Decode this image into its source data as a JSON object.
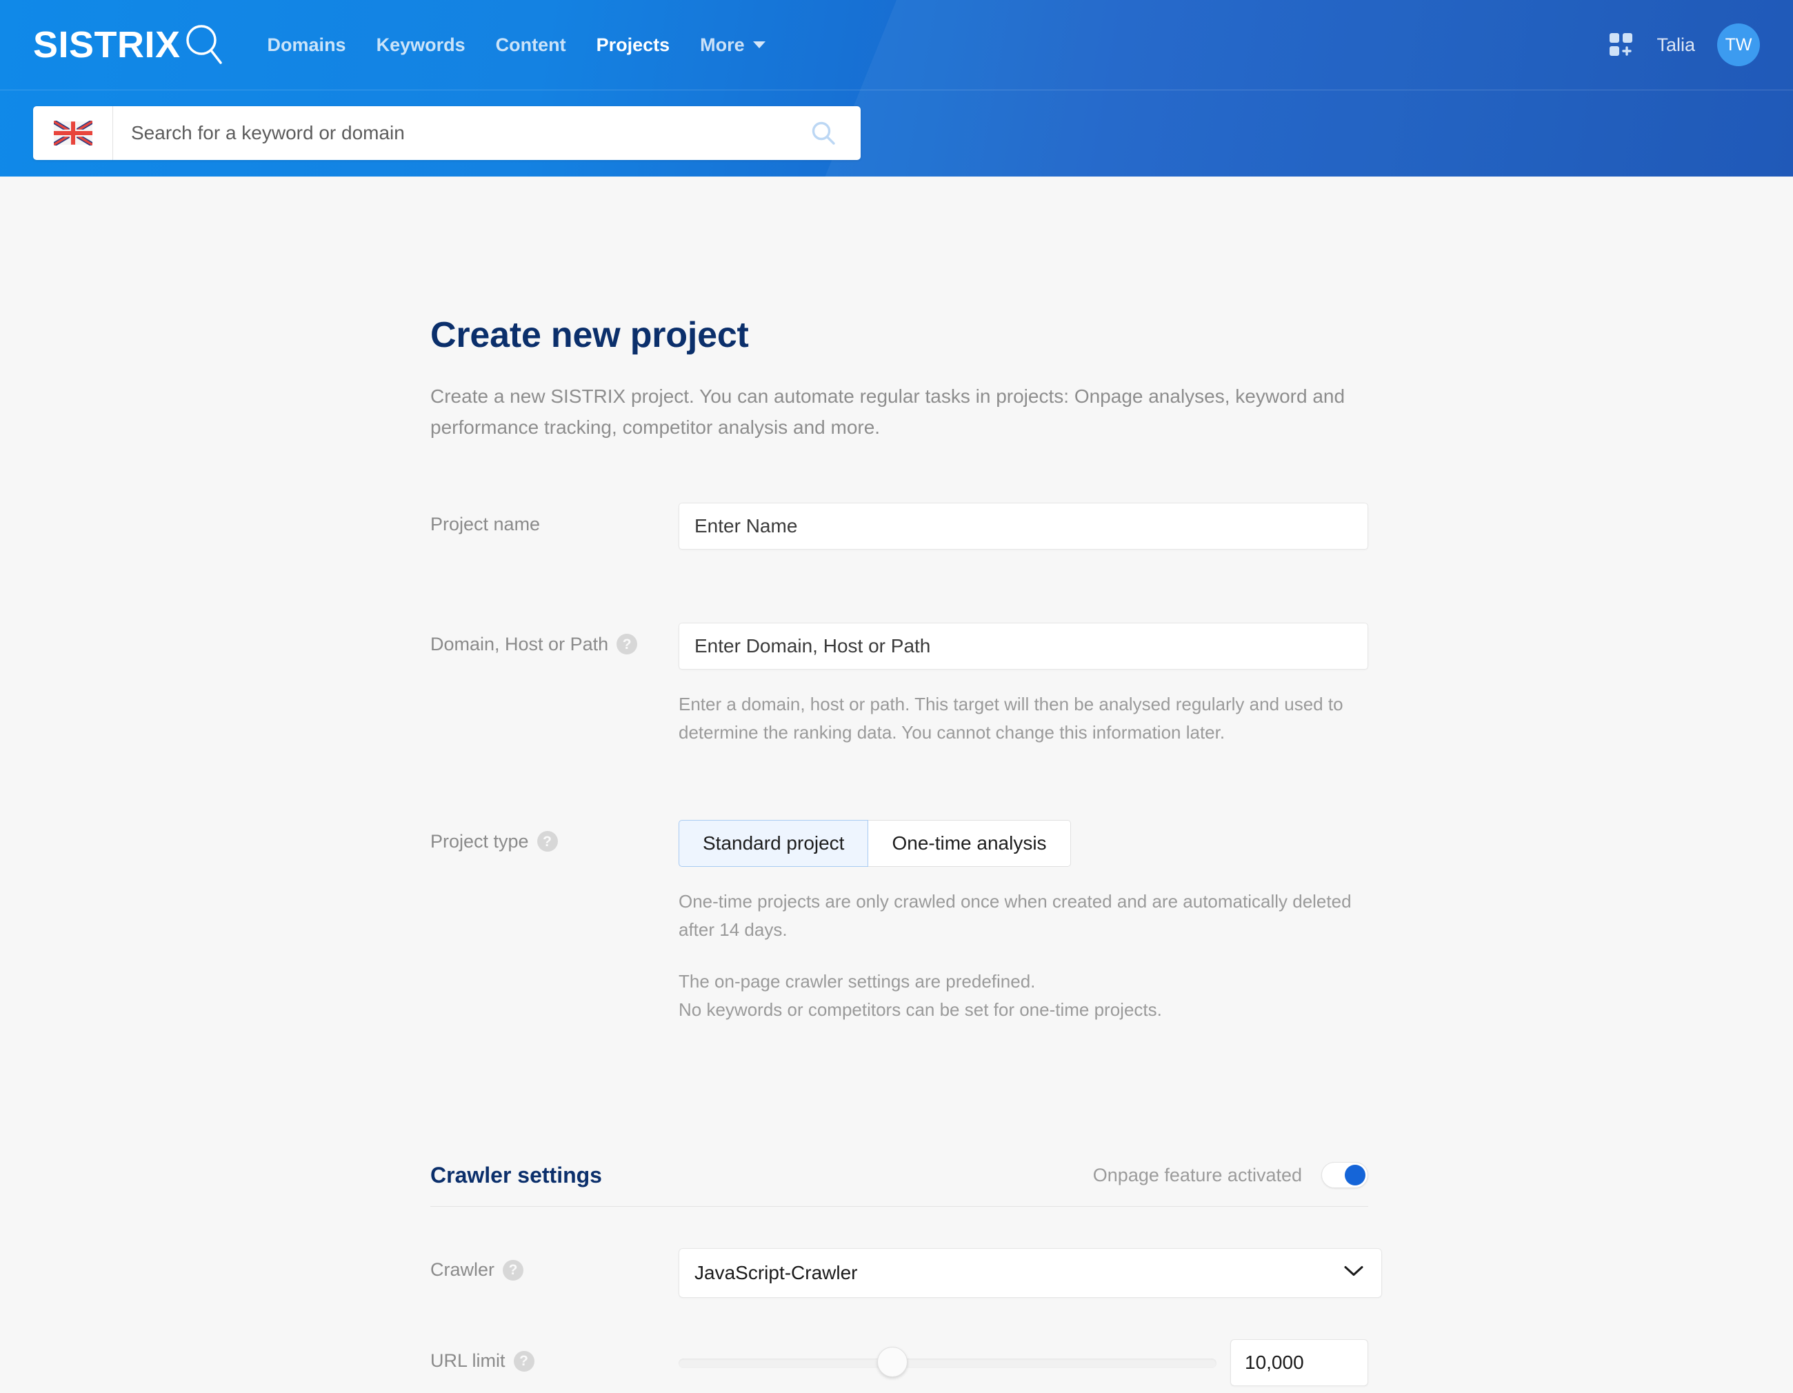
{
  "header": {
    "logo_text": "SISTRIX",
    "logo_icon": "magnifier-icon",
    "nav": [
      {
        "label": "Domains",
        "active": false
      },
      {
        "label": "Keywords",
        "active": false
      },
      {
        "label": "Content",
        "active": false
      },
      {
        "label": "Projects",
        "active": true
      },
      {
        "label": "More",
        "active": false,
        "has_caret": true
      }
    ],
    "apps_icon": "apps-grid-add-icon",
    "user_name": "Talia",
    "avatar_initials": "TW",
    "search": {
      "flag_icon": "uk-flag-icon",
      "placeholder": "Search for a keyword or domain",
      "value": "",
      "go_icon": "search-icon"
    },
    "colors": {
      "gradient_start": "#1089e8",
      "gradient_end": "#1450b4",
      "avatar_bg": "#3c9bf0"
    }
  },
  "page": {
    "title": "Create new project",
    "subtitle": "Create a new SISTRIX project. You can automate regular tasks in projects: Onpage analyses, keyword and performance tracking, competitor analysis and more.",
    "title_color": "#0b2f6b"
  },
  "form": {
    "project_name": {
      "label": "Project name",
      "placeholder": "Enter Name",
      "value": ""
    },
    "domain": {
      "label": "Domain, Host or Path",
      "help_icon": "help-circle-icon",
      "placeholder": "Enter Domain, Host or Path",
      "value": "",
      "hint": "Enter a domain, host or path. This target will then be analysed regularly and used to determine the ranking data. You cannot change this information later."
    },
    "project_type": {
      "label": "Project type",
      "help_icon": "help-circle-icon",
      "options": [
        {
          "label": "Standard project",
          "selected": true
        },
        {
          "label": "One-time analysis",
          "selected": false
        }
      ],
      "hint1": "One-time projects are only crawled once when created and are automatically deleted after 14 days.",
      "hint2_line1": "The on-page crawler settings are predefined.",
      "hint2_line2": "No keywords or competitors can be set for one-time projects."
    }
  },
  "crawler_settings": {
    "title": "Crawler settings",
    "toggle_label": "Onpage feature activated",
    "toggle_on": true,
    "toggle_color": "#1565d8",
    "crawler": {
      "label": "Crawler",
      "help_icon": "help-circle-icon",
      "selected": "JavaScript-Crawler",
      "chevron_icon": "chevron-down-icon"
    },
    "url_limit": {
      "label": "URL limit",
      "help_icon": "help-circle-icon",
      "value": "10,000",
      "slider_percent": 40
    }
  }
}
